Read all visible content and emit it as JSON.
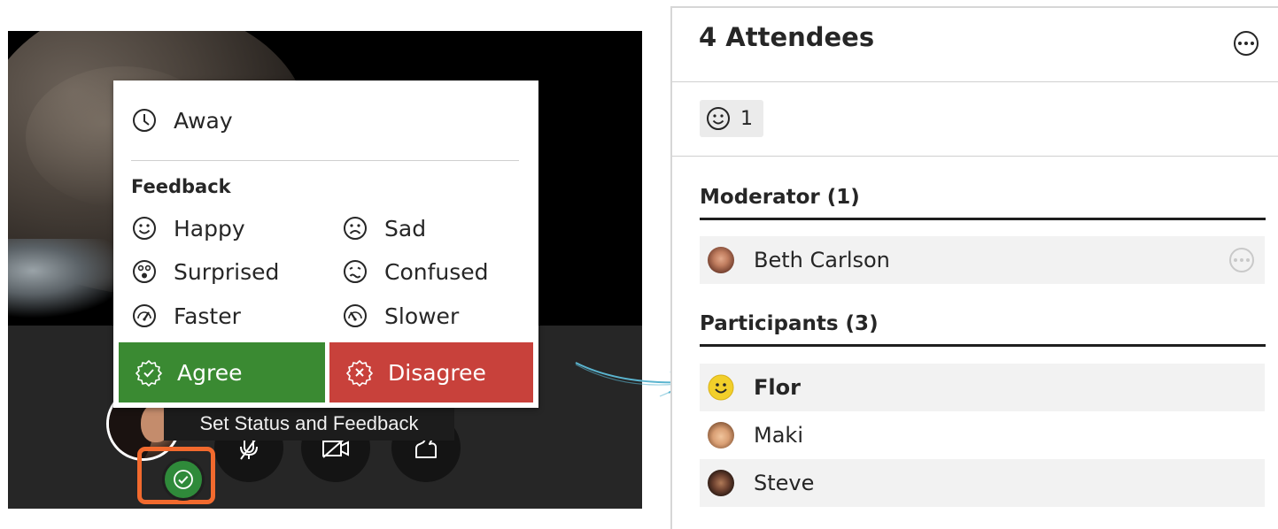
{
  "menu": {
    "away_label": "Away",
    "feedback_heading": "Feedback",
    "items": [
      {
        "label": "Happy",
        "icon": "happy-face-icon"
      },
      {
        "label": "Sad",
        "icon": "sad-face-icon"
      },
      {
        "label": "Surprised",
        "icon": "surprised-face-icon"
      },
      {
        "label": "Confused",
        "icon": "confused-face-icon"
      },
      {
        "label": "Faster",
        "icon": "faster-gauge-icon"
      },
      {
        "label": "Slower",
        "icon": "slower-gauge-icon"
      }
    ],
    "agree_label": "Agree",
    "disagree_label": "Disagree",
    "agree_color": "#3a8a32",
    "disagree_color": "#c8413b"
  },
  "tooltip": "Set Status and Feedback",
  "toolbar": {
    "controls": [
      "status-check-icon",
      "microphone-muted-icon",
      "camera-off-icon",
      "hand-raise-icon"
    ],
    "status_color": "#2f8a3a",
    "highlight_color": "#f26a2e"
  },
  "panel": {
    "title": "4 Attendees",
    "feedback_count": "1",
    "moderator_heading": "Moderator (1)",
    "participants_heading": "Participants (3)",
    "moderators": [
      {
        "name": "Beth Carlson"
      }
    ],
    "participants": [
      {
        "name": "Flor",
        "status": "happy"
      },
      {
        "name": "Maki"
      },
      {
        "name": "Steve"
      }
    ]
  }
}
